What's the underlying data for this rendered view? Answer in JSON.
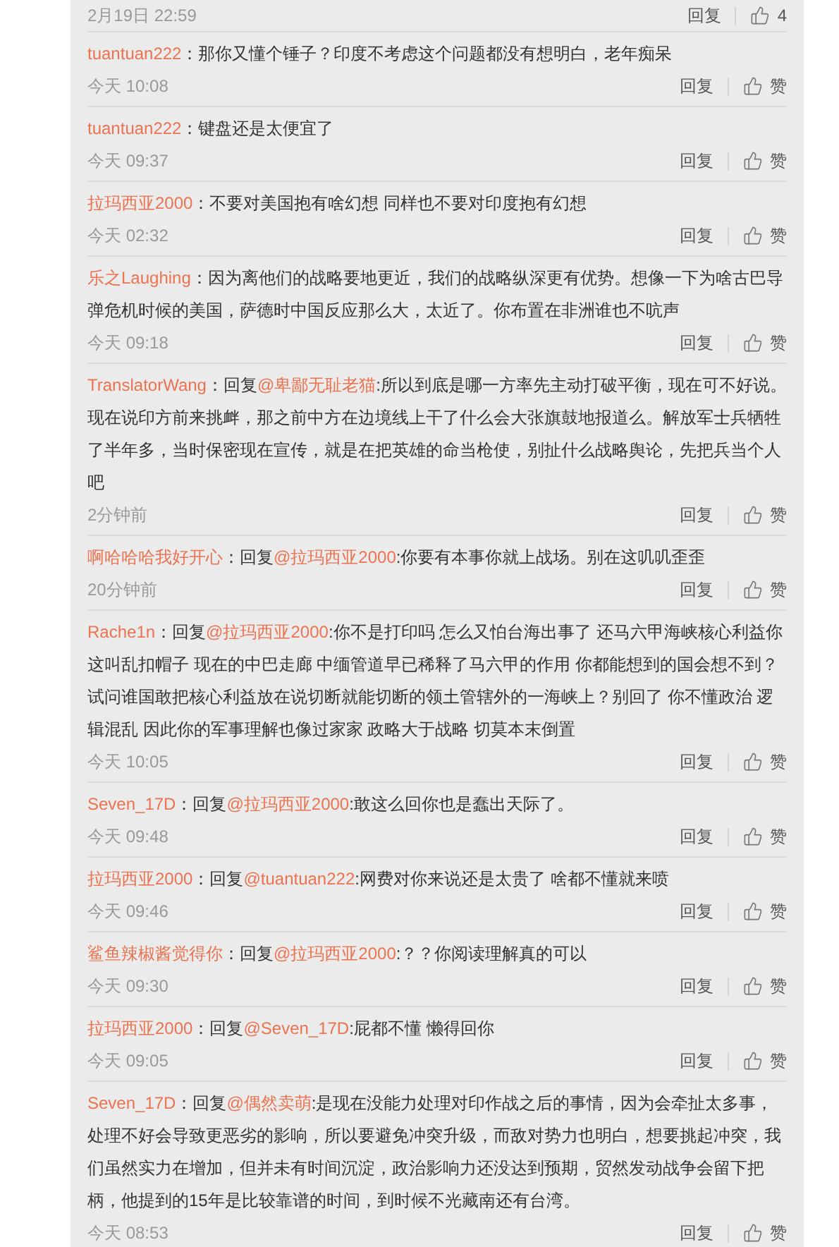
{
  "comments": [
    {
      "time": "2月19日 22:59",
      "reply_label": "回复",
      "like_label": "4"
    },
    {
      "user": "tuantuan222",
      "text": "：那你又懂个锤子？印度不考虑这个问题都没有想明白，老年痴呆",
      "time": "今天 10:08",
      "reply_label": "回复",
      "like_label": "赞"
    },
    {
      "user": "tuantuan222",
      "text": "：键盘还是太便宜了",
      "time": "今天 09:37",
      "reply_label": "回复",
      "like_label": "赞"
    },
    {
      "user": "拉玛西亚2000",
      "text": "：不要对美国抱有啥幻想 同样也不要对印度抱有幻想",
      "time": "今天 02:32",
      "reply_label": "回复",
      "like_label": "赞"
    },
    {
      "user": "乐之Laughing",
      "text": "：因为离他们的战略要地更近，我们的战略纵深更有优势。想像一下为啥古巴导弹危机时候的美国，萨德时中国反应那么大，太近了。你布置在非洲谁也不吭声",
      "time": "今天 09:18",
      "reply_label": "回复",
      "like_label": "赞"
    },
    {
      "user": "TranslatorWang",
      "prefix": "：回复",
      "mention": "@卑鄙无耻老猫",
      "text": ":所以到底是哪一方率先主动打破平衡，现在可不好说。现在说印方前来挑衅，那之前中方在边境线上干了什么会大张旗鼓地报道么。解放军士兵牺牲了半年多，当时保密现在宣传，就是在把英雄的命当枪使，别扯什么战略舆论，先把兵当个人吧",
      "time": "2分钟前",
      "reply_label": "回复",
      "like_label": "赞"
    },
    {
      "user": "啊哈哈哈我好开心",
      "prefix": "：回复",
      "mention": "@拉玛西亚2000",
      "text": ":你要有本事你就上战场。别在这叽叽歪歪",
      "time": "20分钟前",
      "reply_label": "回复",
      "like_label": "赞"
    },
    {
      "user": "Rache1n",
      "prefix": "：回复",
      "mention": "@拉玛西亚2000",
      "text": ":你不是打印吗 怎么又怕台海出事了 还马六甲海峡核心利益你这叫乱扣帽子 现在的中巴走廊 中缅管道早已稀释了马六甲的作用 你都能想到的国会想不到？试问谁国敢把核心利益放在说切断就能切断的领土管辖外的一海峡上？别回了 你不懂政治 逻辑混乱 因此你的军事理解也像过家家 政略大于战略 切莫本末倒置",
      "time": "今天 10:05",
      "reply_label": "回复",
      "like_label": "赞"
    },
    {
      "user": "Seven_17D",
      "prefix": "：回复",
      "mention": "@拉玛西亚2000",
      "text": ":敢这么回你也是蠢出天际了。",
      "time": "今天 09:48",
      "reply_label": "回复",
      "like_label": "赞"
    },
    {
      "user": "拉玛西亚2000",
      "prefix": "：回复",
      "mention": "@tuantuan222",
      "text": ":网费对你来说还是太贵了 啥都不懂就来喷",
      "time": "今天 09:46",
      "reply_label": "回复",
      "like_label": "赞"
    },
    {
      "user": "鲨鱼辣椒酱觉得你",
      "prefix": "：回复",
      "mention": "@拉玛西亚2000",
      "text": ":？？你阅读理解真的可以",
      "time": "今天 09:30",
      "reply_label": "回复",
      "like_label": "赞"
    },
    {
      "user": "拉玛西亚2000",
      "prefix": "：回复",
      "mention": "@Seven_17D",
      "text": ":屁都不懂 懒得回你",
      "time": "今天 09:05",
      "reply_label": "回复",
      "like_label": "赞"
    },
    {
      "user": "Seven_17D",
      "prefix": "：回复",
      "mention": "@偶然卖萌",
      "text": ":是现在没能力处理对印作战之后的事情，因为会牵扯太多事，处理不好会导致更恶劣的影响，所以要避免冲突升级，而敌对势力也明白，想要挑起冲突，我们虽然实力在增加，但并未有时间沉淀，政治影响力还没达到预期，贸然发动战争会留下把柄，他提到的15年是比较靠谱的时间，到时候不光藏南还有台湾。",
      "time": "今天 08:53",
      "reply_label": "回复",
      "like_label": "赞"
    }
  ]
}
